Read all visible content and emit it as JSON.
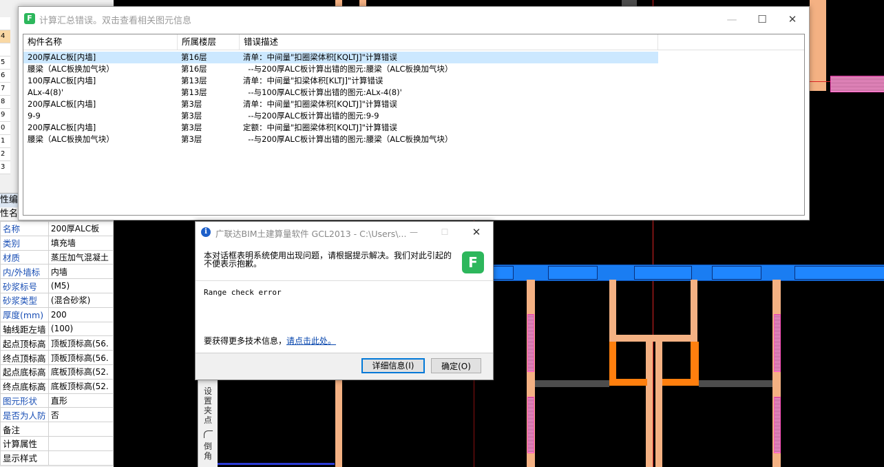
{
  "error_summary_window": {
    "title": "计算汇总错误。双击查看相关图元信息",
    "columns": [
      "构件名称",
      "所属楼层",
      "错误描述"
    ],
    "rows": [
      {
        "name": "200厚ALC板[内墙]",
        "floor": "第16层",
        "desc": "清单：中间量\"扣圈梁体积[KQLTJ]\"计算错误"
      },
      {
        "name": "腰梁（ALC板换加气块）",
        "floor": "第16层",
        "desc": "  --与200厚ALC板计算出错的图元:腰梁（ALC板换加气块）"
      },
      {
        "name": "100厚ALC板[内墙]",
        "floor": "第13层",
        "desc": "清单：中间量\"扣梁体积[KLTJ]\"计算错误"
      },
      {
        "name": "ALx-4(8)'",
        "floor": "第13层",
        "desc": "  --与100厚ALC板计算出错的图元:ALx-4(8)'"
      },
      {
        "name": "200厚ALC板[内墙]",
        "floor": "第3层",
        "desc": "清单：中间量\"扣圈梁体积[KQLTJ]\"计算错误"
      },
      {
        "name": "9-9",
        "floor": "第3层",
        "desc": "  --与200厚ALC板计算出错的图元:9-9"
      },
      {
        "name": "200厚ALC板[内墙]",
        "floor": "第3层",
        "desc": "定额：中间量\"扣圈梁体积[KQLTJ]\"计算错误"
      },
      {
        "name": "腰梁（ALC板换加气块）",
        "floor": "第3层",
        "desc": "  --与200厚ALC板计算出错的图元:腰梁（ALC板换加气块）"
      }
    ]
  },
  "error_dialog": {
    "title": "广联达BIM土建算量软件 GCL2013 - C:\\Users\\...",
    "message": "本对话框表明系统使用出现问题，请根据提示解决。我们对此引起的不便表示抱歉。",
    "error_text": "Range check error",
    "more_info_prefix": "要获得更多技术信息，",
    "more_info_link": "请点击此处。",
    "details_button": "详细信息(I)",
    "ok_button": "确定(O)"
  },
  "property_panel": {
    "header": "性编辑",
    "col_header": "性名",
    "row_numbers": [
      "",
      "4",
      "",
      "5",
      "6",
      "7",
      "8",
      "9",
      "0",
      "1",
      "2",
      "3"
    ],
    "rows": [
      {
        "key": "名称",
        "value": "200厚ALC板"
      },
      {
        "key": "类别",
        "value": "填充墙"
      },
      {
        "key": "材质",
        "value": "蒸压加气混凝土"
      },
      {
        "key": "内/外墙标",
        "value": "内墙"
      },
      {
        "key": "砂浆标号",
        "value": "(M5)"
      },
      {
        "key": "砂浆类型",
        "value": "(混合砂浆)"
      },
      {
        "key": "厚度(mm)",
        "value": "200"
      },
      {
        "key": "轴线距左墙",
        "value": "(100)"
      },
      {
        "key": "起点顶标高",
        "value": "顶板顶标高(56."
      },
      {
        "key": "终点顶标高",
        "value": "顶板顶标高(56."
      },
      {
        "key": "起点底标高",
        "value": "底板顶标高(52."
      },
      {
        "key": "终点底标高",
        "value": "底板顶标高(52."
      },
      {
        "key": "图元形状",
        "value": "直形"
      },
      {
        "key": "是否为人防",
        "value": "否"
      },
      {
        "key": "备注",
        "value": ""
      },
      {
        "key": "计算属性",
        "value": ""
      },
      {
        "key": "显示样式",
        "value": ""
      }
    ]
  },
  "side_toolbar": {
    "set_grip": "设置夹点",
    "chamfer": "倒角"
  },
  "colors": {
    "wall": "#f4b183",
    "wall_highlight": "#ff7f0e",
    "beam": "#1a7df2",
    "selected_row": "#cce8ff",
    "logo_green": "#2db75c"
  }
}
